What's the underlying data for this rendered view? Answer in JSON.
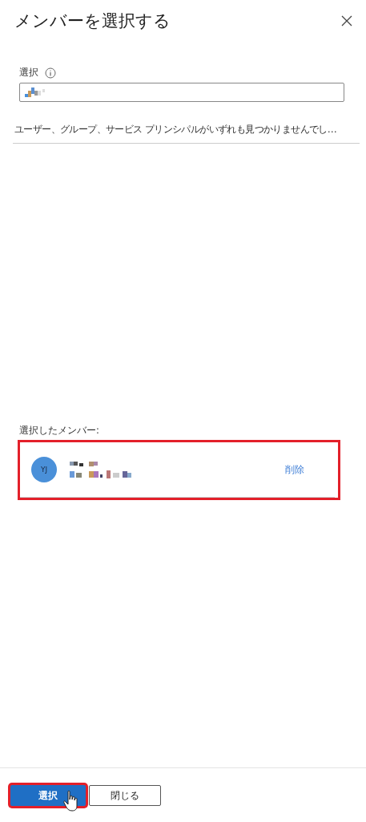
{
  "panel": {
    "title": "メンバーを選択する"
  },
  "search": {
    "label": "選択",
    "value_redacted": true
  },
  "results": [
    {
      "text": "ユーザー、グループ、サービス プリンシパルがいずれも見つかりませんでし…"
    }
  ],
  "selected_members": {
    "heading": "選択したメンバー:",
    "highlighted": true,
    "items": [
      {
        "initials": "YJ",
        "color": "#4a90d9",
        "remove": "削除"
      }
    ]
  },
  "footer": {
    "buttons": [
      {
        "label": "選択",
        "kind": "primary",
        "highlighted": true,
        "cursor": true
      },
      {
        "label": "閉じる",
        "kind": "secondary",
        "highlighted": false,
        "cursor": false
      }
    ]
  }
}
